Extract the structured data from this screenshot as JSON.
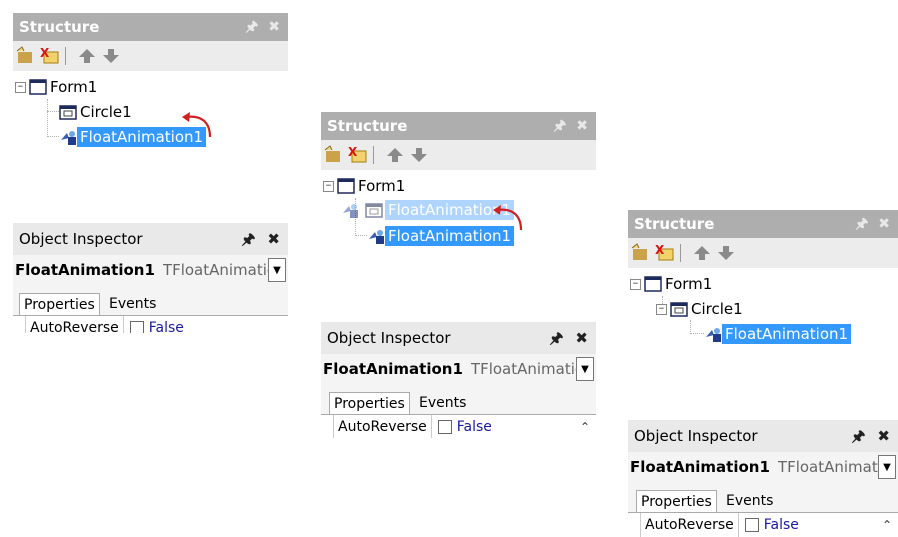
{
  "colors": {
    "selection": "#3399ff",
    "title_bar": "#aeaeae",
    "arrow": "#d02020"
  },
  "icons": [
    "new-item-icon",
    "delete-item-icon",
    "move-up-icon",
    "move-down-icon",
    "form-icon",
    "circle-component-icon",
    "float-animation-icon",
    "pin-icon",
    "close-icon",
    "dropdown-arrow-icon"
  ],
  "panels": [
    {
      "structure_title": "Structure",
      "tree": {
        "root": "Form1",
        "child": "Circle1",
        "animation": "FloatAnimation1",
        "drag_ghost": ""
      },
      "inspector": {
        "title": "Object Inspector",
        "object_name": "FloatAnimation1",
        "object_type": "TFloatAnimation",
        "tab_properties": "Properties",
        "tab_events": "Events",
        "prop_name": "AutoReverse",
        "prop_value": "False"
      }
    },
    {
      "structure_title": "Structure",
      "tree": {
        "root": "Form1",
        "child": "",
        "animation": "FloatAnimation1",
        "drag_ghost": "FloatAnimation1"
      },
      "inspector": {
        "title": "Object Inspector",
        "object_name": "FloatAnimation1",
        "object_type": "TFloatAnimation",
        "tab_properties": "Properties",
        "tab_events": "Events",
        "prop_name": "AutoReverse",
        "prop_value": "False"
      }
    },
    {
      "structure_title": "Structure",
      "tree": {
        "root": "Form1",
        "child": "Circle1",
        "animation": "FloatAnimation1",
        "drag_ghost": ""
      },
      "inspector": {
        "title": "Object Inspector",
        "object_name": "FloatAnimation1",
        "object_type": "TFloatAnimation",
        "tab_properties": "Properties",
        "tab_events": "Events",
        "prop_name": "AutoReverse",
        "prop_value": "False"
      }
    }
  ]
}
